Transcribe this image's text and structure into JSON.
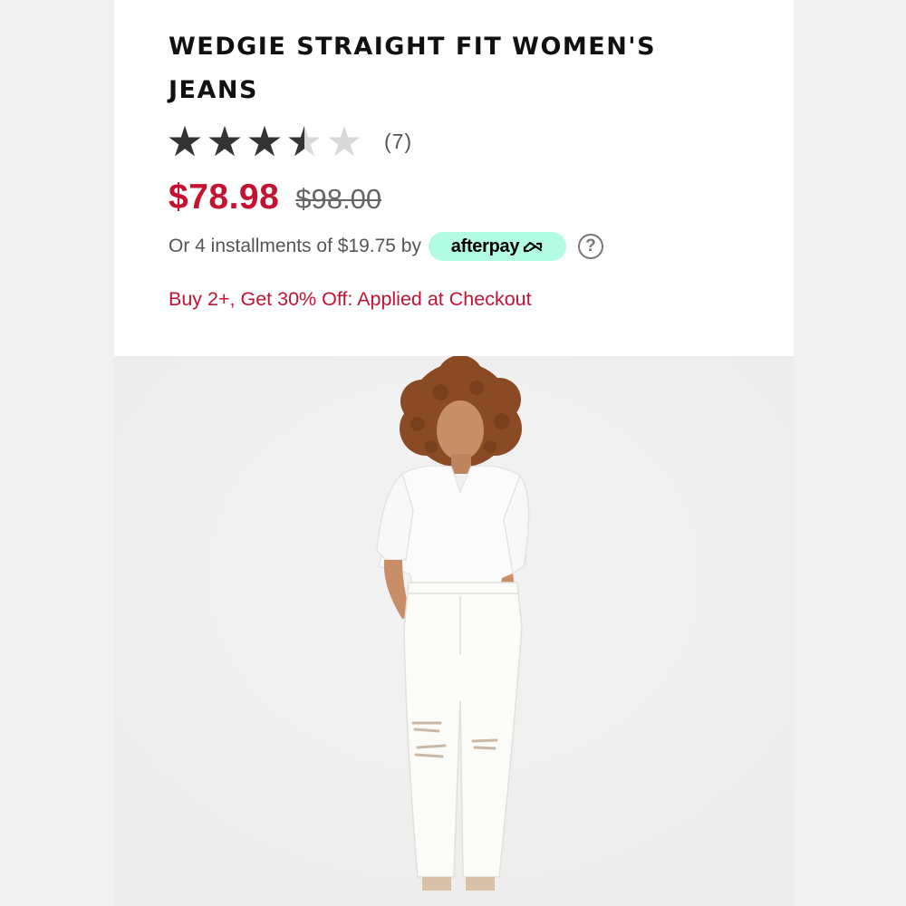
{
  "product": {
    "title": "WEDGIE STRAIGHT FIT WOMEN'S JEANS",
    "rating_value": 3.5,
    "rating_max": 5,
    "review_count": "(7)",
    "sale_price": "$78.98",
    "original_price": "$98.00",
    "installments_text": "Or 4 installments of $19.75 by",
    "afterpay_label": "afterpay",
    "promo_text": "Buy 2+, Get 30% Off: Applied at Checkout"
  },
  "icons": {
    "star": "star-icon",
    "help": "question-circle-icon",
    "afterpay": "afterpay-loop-icon"
  },
  "colors": {
    "sale": "#c41230",
    "afterpay_bg": "#b2fce4",
    "star_filled": "#333333",
    "star_empty": "#d9d9d9"
  }
}
